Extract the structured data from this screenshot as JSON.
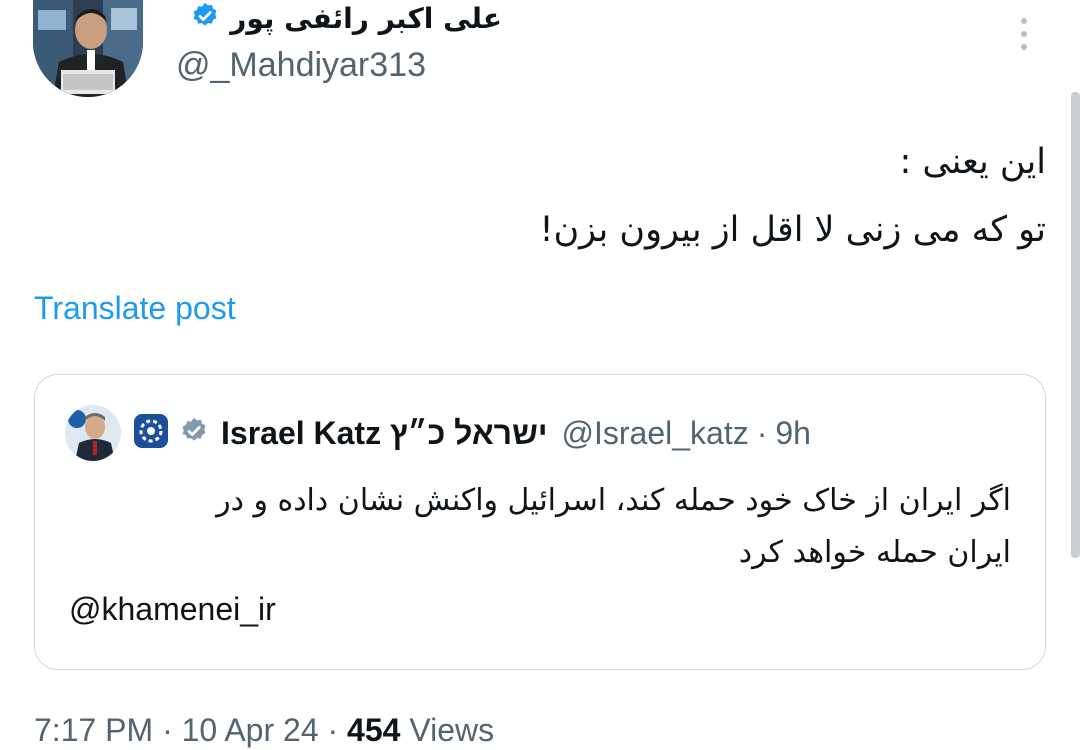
{
  "author": {
    "display_name": "علی اکبر رائفی پور",
    "handle": "@_Mahdiyar313",
    "verified_icon": "verified-badge-icon",
    "badge_color": "#1d9bf0"
  },
  "tweet": {
    "lines": [
      "این یعنی :",
      "تو که می زنی لا اقل از بیرون بزن!"
    ],
    "translate_label": "Translate post"
  },
  "quoted": {
    "name": "Israel Katz ישראל כ״ץ",
    "handle": "@Israel_katz",
    "separator": "·",
    "time": "9h",
    "lines": [
      "اگر ایران از خاک خود حمله کند، اسرائیل واکنش نشان داده و در",
      "ایران حمله خواهد کرد"
    ],
    "mention": "@khamenei_ir"
  },
  "meta": {
    "time": "7:17 PM",
    "sep1": " · ",
    "date": "10 Apr 24",
    "sep2": " · ",
    "views_count": "454",
    "views_label": " Views"
  },
  "colors": {
    "link": "#1d9bf0",
    "secondary_text": "#536471",
    "border": "#cfd9de"
  }
}
